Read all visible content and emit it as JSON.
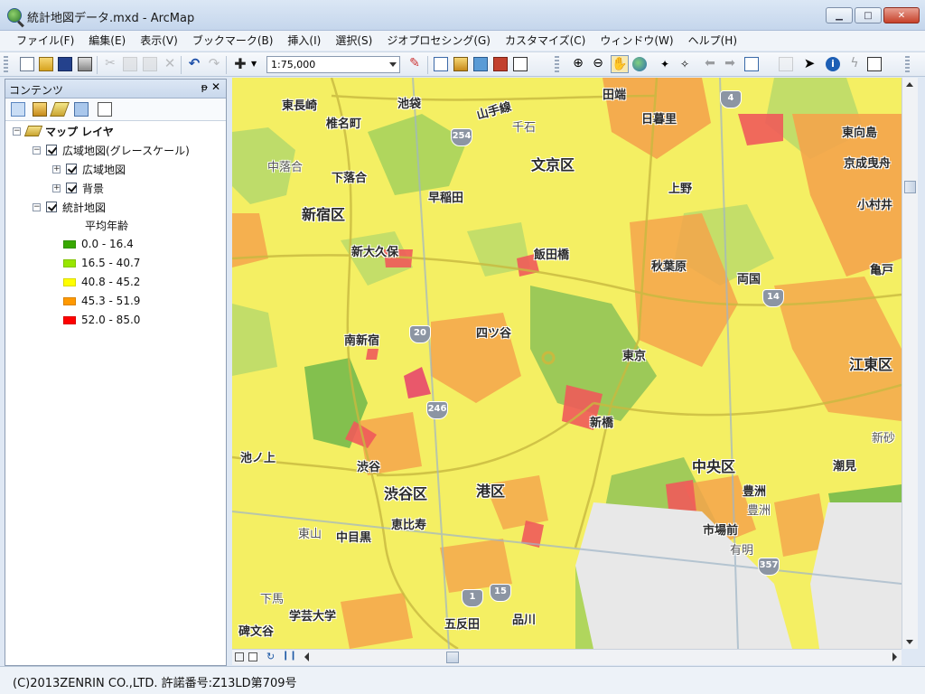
{
  "window": {
    "title": "統計地図データ.mxd - ArcMap"
  },
  "menu": [
    "ファイル(F)",
    "編集(E)",
    "表示(V)",
    "ブックマーク(B)",
    "挿入(I)",
    "選択(S)",
    "ジオプロセシング(G)",
    "カスタマイズ(C)",
    "ウィンドウ(W)",
    "ヘルプ(H)"
  ],
  "toolbar": {
    "scale": "1:75,000"
  },
  "toc": {
    "title": "コンテンツ",
    "tree": {
      "root": "マップ レイヤ",
      "group": "広域地図(グレースケール)",
      "sub1": "広域地図",
      "sub2": "背景",
      "stat_layer": "統計地図",
      "field": "平均年齢",
      "classes": [
        {
          "label": "0.0 - 16.4",
          "color": "#38a800"
        },
        {
          "label": "16.5 - 40.7",
          "color": "#98e600"
        },
        {
          "label": "40.8 - 45.2",
          "color": "#ffff00"
        },
        {
          "label": "45.3 - 51.9",
          "color": "#ff9900"
        },
        {
          "label": "52.0 - 85.0",
          "color": "#ff0000"
        }
      ]
    }
  },
  "map": {
    "labels": {
      "higashi_nagasaki": "東長崎",
      "ikebukuro": "池袋",
      "yamanote": "山手線",
      "tabata": "田端",
      "shiiname": "椎名町",
      "sengoku": "千石",
      "nippori": "日暮里",
      "mukojima": "東向島",
      "nakaochiai": "中落合",
      "shimoochiai": "下落合",
      "bunkyo": "文京区",
      "keisei": "京成曳舟",
      "waseda": "早稲田",
      "ueno": "上野",
      "komurai": "小村井",
      "shinjuku_ku": "新宿区",
      "shinokubo": "新大久保",
      "iidabashi": "飯田橋",
      "akihabara": "秋葉原",
      "ryogoku": "両国",
      "kameido": "亀戸",
      "yotsuya": "四ツ谷",
      "minamishinjuku": "南新宿",
      "tokyo": "東京",
      "koto": "江東区",
      "shinbashi": "新橋",
      "shinsuna": "新砂",
      "ikenoue": "池ノ上",
      "shibuya": "渋谷",
      "chuo": "中央区",
      "shiomi": "潮見",
      "shibuya_ku": "渋谷区",
      "minato": "港区",
      "toyosu1": "豊洲",
      "toyosu2": "豊洲",
      "ebisu": "恵比寿",
      "higashiyama": "東山",
      "nakameguro": "中目黒",
      "shijomae": "市場前",
      "ariake": "有明",
      "shimouma": "下馬",
      "gakugei": "学芸大学",
      "gotanda": "五反田",
      "shinagawa": "品川",
      "himonya": "碑文谷"
    },
    "routes": {
      "r4": "4",
      "r254": "254",
      "r14": "14",
      "r20": "20",
      "r246": "246",
      "r357": "357",
      "r1": "1",
      "r15": "15"
    }
  },
  "status": {
    "text": "(C)2013ZENRIN CO.,LTD. 許諾番号:Z13LD第709号"
  }
}
